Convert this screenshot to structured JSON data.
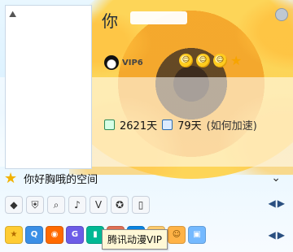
{
  "profile": {
    "name_visible_part": "你",
    "vip_label": "VIP6",
    "days_online": "2621天",
    "days_accel": "79天",
    "accel_link": "(如何加速)"
  },
  "space": {
    "label": "你好胸哦的空间"
  },
  "toolbar": {
    "icons": [
      "diamond-icon",
      "shield-icon",
      "search-icon",
      "music-icon",
      "v-icon",
      "star-icon",
      "book-icon"
    ]
  },
  "apps": {
    "icons": [
      "star-app-icon",
      "qzone-icon",
      "pet-icon",
      "game-icon",
      "mobile-icon",
      "chat-icon",
      "vip-icon",
      "bell-icon",
      "face-icon",
      "panel-icon"
    ],
    "tooltip": "腾讯动漫VIP"
  },
  "colors": {
    "accent": "#f7a400",
    "link": "#2b6cb0"
  }
}
